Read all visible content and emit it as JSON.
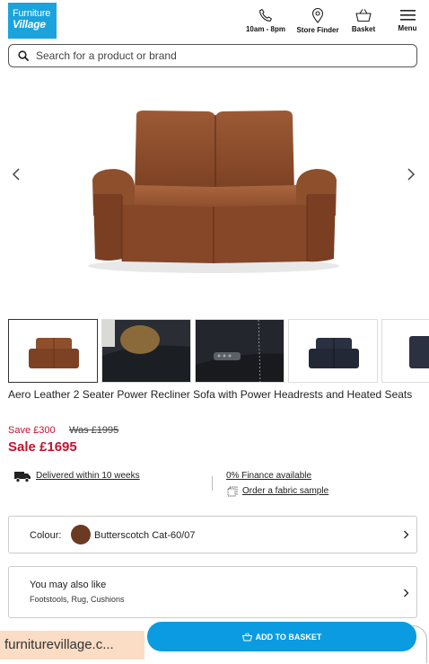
{
  "header": {
    "logo_line1": "Furniture",
    "logo_line2": "Village",
    "hours_label": "10am - 8pm",
    "store_finder_label": "Store Finder",
    "basket_label": "Basket",
    "menu_label": "Menu"
  },
  "search": {
    "placeholder": "Search for a product or brand"
  },
  "product": {
    "title": "Aero Leather 2 Seater Power Recliner Sofa with Power Headrests and Heated Seats",
    "save_text": "Save £300",
    "was_text": "Was £1995",
    "sale_text": "Sale £1695"
  },
  "info": {
    "delivery": "Delivered within 10 weeks",
    "finance": "0% Finance available",
    "fabric_sample": "Order a fabric sample"
  },
  "colour": {
    "label": "Colour:",
    "value": "Butterscotch Cat-60/07",
    "swatch_color": "#6b3a22"
  },
  "also_like": {
    "title": "You may also like",
    "subtitle": "Footstools, Rug, Cushions"
  },
  "cta": {
    "add_to_basket": "ADD TO BASKET"
  },
  "browser": {
    "url_chip": "furniturevillage.c..."
  },
  "colors": {
    "brand_blue": "#1aa3dd",
    "cta_blue": "#0b9be0",
    "sale_red": "#c8102e"
  }
}
